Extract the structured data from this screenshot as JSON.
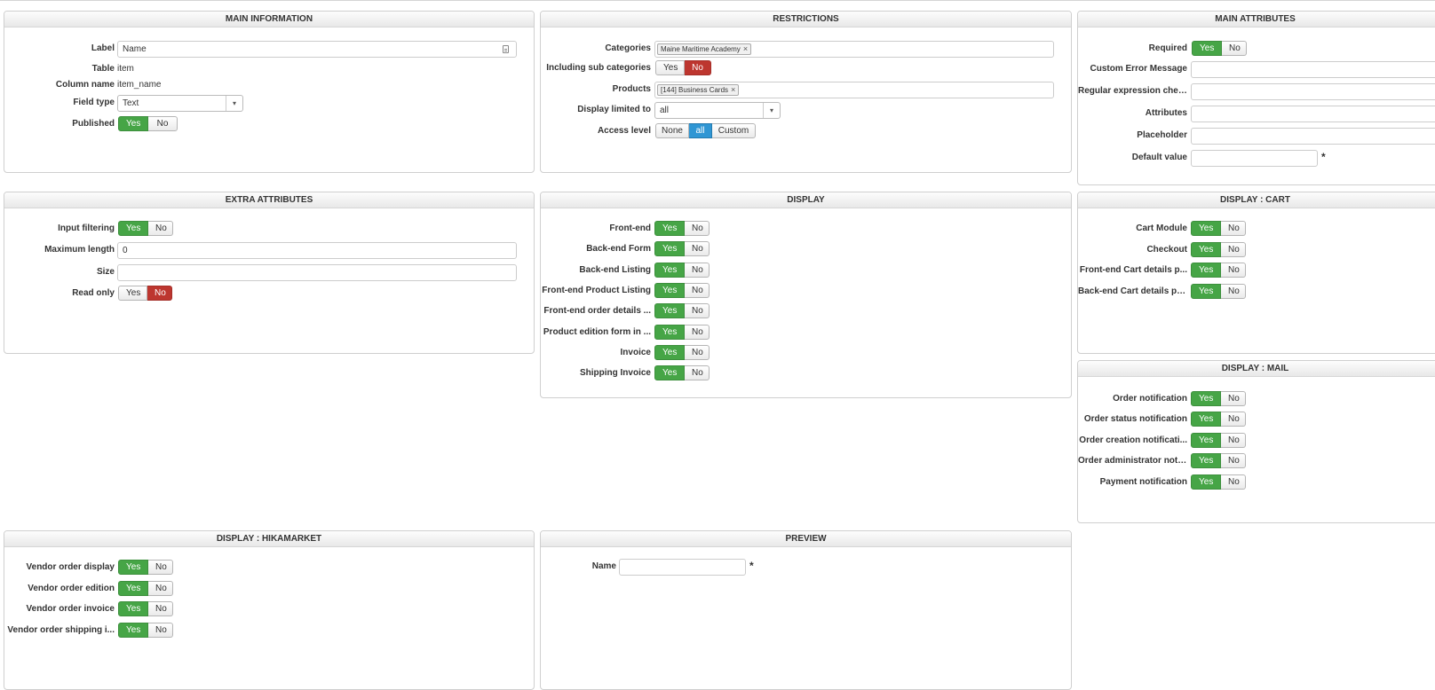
{
  "panels": {
    "main_information": {
      "title": "MAIN INFORMATION",
      "label_label": "Label",
      "label_value": "Name",
      "table_label": "Table",
      "table_value": "item",
      "column_label": "Column name",
      "column_value": "item_name",
      "field_type_label": "Field type",
      "field_type_value": "Text",
      "published_label": "Published"
    },
    "restrictions": {
      "title": "RESTRICTIONS",
      "categories_label": "Categories",
      "category_chip": "Maine Maritime Academy",
      "subcat_label": "Including sub categories",
      "products_label": "Products",
      "product_chip": "[144] Business Cards",
      "display_limited_label": "Display limited to",
      "display_limited_value": "all",
      "access_label": "Access level",
      "access_none": "None",
      "access_all": "all",
      "access_custom": "Custom"
    },
    "main_attributes": {
      "title": "MAIN ATTRIBUTES",
      "required_label": "Required",
      "custom_error_label": "Custom Error Message",
      "regex_label": "Regular expression check",
      "attributes_label": "Attributes",
      "placeholder_label": "Placeholder",
      "default_label": "Default value",
      "required_mark": "*"
    },
    "extra_attributes": {
      "title": "EXTRA ATTRIBUTES",
      "input_filtering_label": "Input filtering",
      "max_length_label": "Maximum length",
      "max_length_value": "0",
      "size_label": "Size",
      "read_only_label": "Read only"
    },
    "display": {
      "title": "DISPLAY",
      "rows": [
        "Front-end",
        "Back-end Form",
        "Back-end Listing",
        "Front-end Product Listing",
        "Front-end order details ...",
        "Product edition form in ...",
        "Invoice",
        "Shipping Invoice"
      ]
    },
    "display_cart": {
      "title": "DISPLAY : CART",
      "rows": [
        "Cart Module",
        "Checkout",
        "Front-end Cart details p...",
        "Back-end Cart details pa..."
      ]
    },
    "display_mail": {
      "title": "DISPLAY : MAIL",
      "rows": [
        "Order notification",
        "Order status notification",
        "Order creation notificati...",
        "Order administrator noti...",
        "Payment notification"
      ]
    },
    "display_hikamarket": {
      "title": "DISPLAY : HIKAMARKET",
      "rows": [
        "Vendor order display",
        "Vendor order edition",
        "Vendor order invoice",
        "Vendor order shipping i..."
      ]
    },
    "preview": {
      "title": "PREVIEW",
      "name_label": "Name",
      "required_mark": "*"
    }
  },
  "toggle": {
    "yes": "Yes",
    "no": "No"
  },
  "colors": {
    "yes_active": "#46a546",
    "no_active": "#bd362f",
    "all_active": "#2f96d4"
  }
}
